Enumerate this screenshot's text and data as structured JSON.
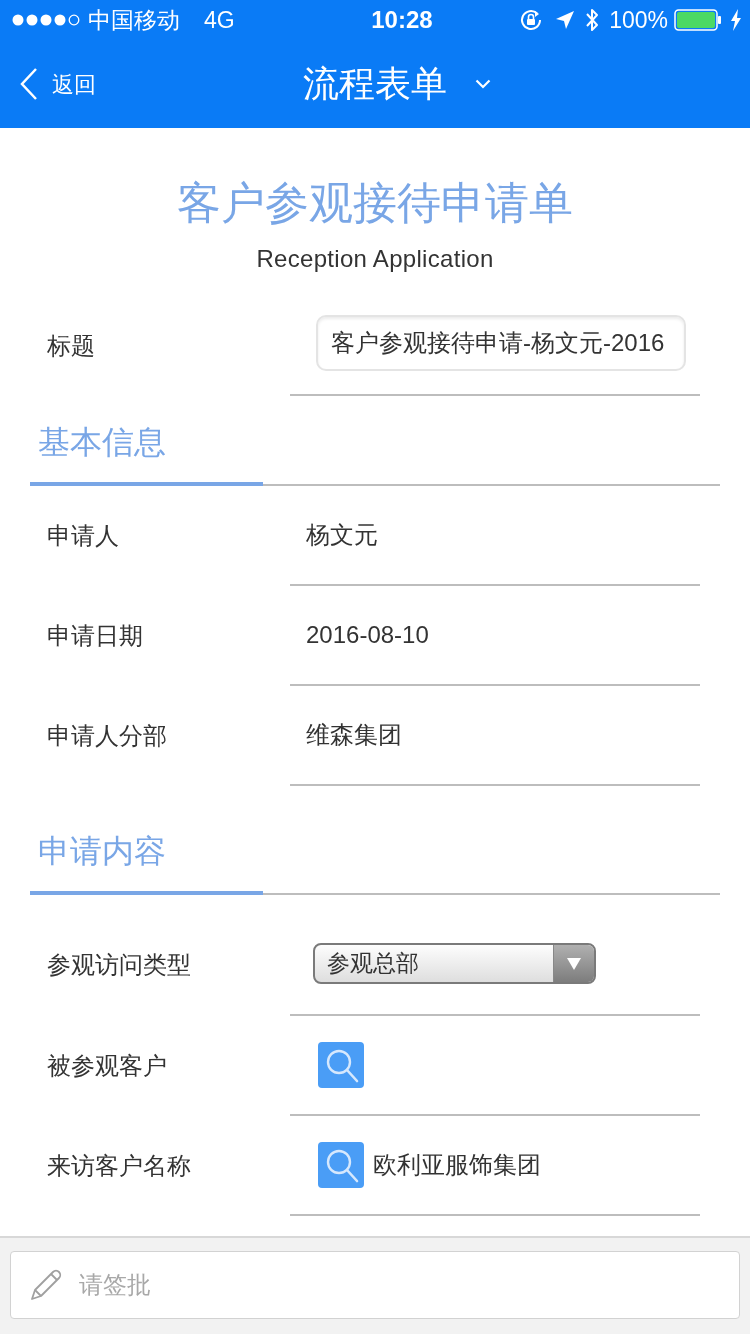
{
  "status_bar": {
    "carrier": "中国移动",
    "network": "4G",
    "time": "10:28",
    "battery": "100%"
  },
  "nav_bar": {
    "back": "返回",
    "title": "流程表单"
  },
  "form": {
    "title": "客户参观接待申请单",
    "subtitle": "Reception Application",
    "fields": [
      {
        "kind": "input",
        "label": "标题",
        "value": "客户参观接待申请-杨文元-2016"
      }
    ],
    "sections": [
      {
        "title": "基本信息",
        "fields": [
          {
            "kind": "text",
            "label": "申请人",
            "value": "杨文元"
          },
          {
            "kind": "text",
            "label": "申请日期",
            "value": "2016-08-10"
          },
          {
            "kind": "text",
            "label": "申请人分部",
            "value": "维森集团"
          }
        ]
      },
      {
        "title": "申请内容",
        "fields": [
          {
            "kind": "select",
            "label": "参观访问类型",
            "value": "参观总部"
          },
          {
            "kind": "lookup",
            "label": "被参观客户"
          },
          {
            "kind": "lookup",
            "label": "来访客户名称",
            "value": "欧利亚服饰集团"
          }
        ]
      }
    ]
  },
  "comment_bar": {
    "placeholder": "请签批"
  }
}
